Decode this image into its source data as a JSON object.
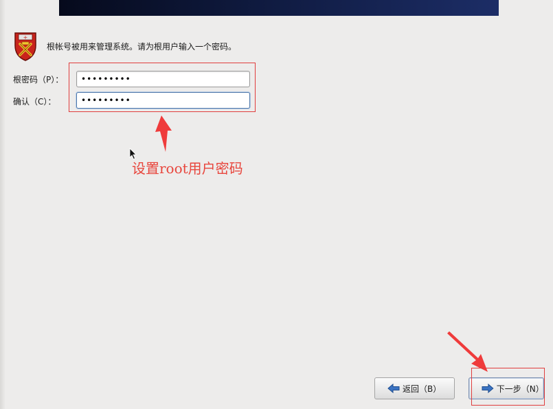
{
  "intro": {
    "text": "根帐号被用来管理系统。请为根用户输入一个密码。"
  },
  "form": {
    "password_label": "根密码（P）：",
    "password_value": "•••••••••",
    "confirm_label": "确认（C）：",
    "confirm_value": "•••••••••"
  },
  "annotation": {
    "caption": "设置root用户密码",
    "color": "#e8453c"
  },
  "buttons": {
    "back_label": "返回（B）",
    "next_label": "下一步（N）"
  },
  "icons": {
    "installer": "shield-icon",
    "back": "arrow-left-icon",
    "next": "arrow-right-icon"
  }
}
